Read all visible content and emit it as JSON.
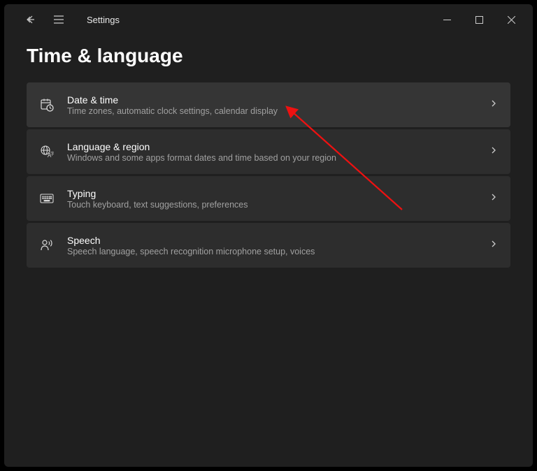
{
  "app_title": "Settings",
  "page_title": "Time & language",
  "items": [
    {
      "icon": "calendar-clock-icon",
      "title": "Date & time",
      "subtitle": "Time zones, automatic clock settings, calendar display",
      "highlighted": true
    },
    {
      "icon": "globe-language-icon",
      "title": "Language & region",
      "subtitle": "Windows and some apps format dates and time based on your region",
      "highlighted": false
    },
    {
      "icon": "keyboard-icon",
      "title": "Typing",
      "subtitle": "Touch keyboard, text suggestions, preferences",
      "highlighted": false
    },
    {
      "icon": "speech-icon",
      "title": "Speech",
      "subtitle": "Speech language, speech recognition microphone setup, voices",
      "highlighted": false
    }
  ]
}
